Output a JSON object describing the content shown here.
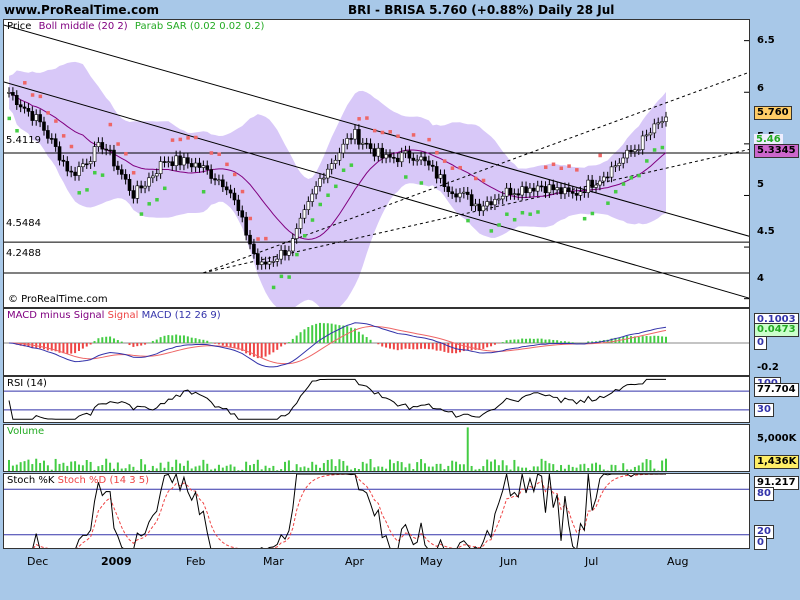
{
  "header": {
    "site": "www.ProRealTime.com",
    "title": "BRI - BRISA 5.760 (+0.88%) Daily 28 Jul"
  },
  "main": {
    "legend": {
      "price": "Price",
      "boll": "Boll middle (20 2)",
      "sar": "Parab SAR (0.02 0.02 0.2)"
    },
    "watermark": "© ProRealTime.com",
    "levels": [
      {
        "label": "5.4119",
        "value": 5.4119
      },
      {
        "label": "4.5484",
        "value": 4.5484
      },
      {
        "label": "4.2488",
        "value": 4.2488
      }
    ],
    "yticks": [
      "6.5",
      "6",
      "5.5",
      "5",
      "4.5",
      "4"
    ],
    "last_price": "5.760",
    "boll_tag": "5.46",
    "sar_tag": "5.3345"
  },
  "macd": {
    "label_a": "MACD minus Signal",
    "label_b": "Signal",
    "label_c": "MACD (12 26 9)",
    "tick": "-0.2",
    "tag_top": "0.1003",
    "tag": "0.0473",
    "tag_zero": "0"
  },
  "rsi": {
    "label": "RSI (14)",
    "tag": "77.704",
    "tag_low": "30",
    "tag_top": "100"
  },
  "volume": {
    "label": "Volume",
    "tick": "5,000K",
    "tag": "1,436K"
  },
  "stoch": {
    "label_a": "Stoch %K",
    "label_b": "Stoch %D (14 3 5)",
    "tag": "91.217",
    "tag_80": "80",
    "tag_20": "20",
    "tag_0": "0"
  },
  "xaxis": [
    "Dec",
    "2009",
    "Feb",
    "Mar",
    "Apr",
    "May",
    "Jun",
    "Jul",
    "Aug"
  ],
  "colors": {
    "bg": "#a8c8e8",
    "boll_fill": "#d8c8f8",
    "sar_up": "#44cc44",
    "sar_down": "#ee6666",
    "macd": "#3333aa",
    "signal": "#ee6666",
    "hist_up": "#44cc44",
    "hist_down": "#ee4444",
    "last_tag": "#ffcc66",
    "sar_tag_color": "#cc66cc"
  },
  "chart_data": {
    "type": "line",
    "title": "BRI - BRISA 5.760 (+0.88%) Daily 28 Jul",
    "xlabel": "",
    "ylabel": "",
    "x": [
      "Dec",
      "2009",
      "Feb",
      "Mar",
      "Apr",
      "May",
      "Jun",
      "Jul",
      "Aug"
    ],
    "ylim": [
      3.9,
      6.7
    ],
    "series": [
      {
        "name": "Price",
        "values": [
          6.0,
          5.7,
          5.2,
          5.5,
          5.0,
          5.35,
          5.3,
          5.1,
          4.3,
          4.5,
          5.2,
          5.6,
          5.35,
          5.4,
          5.1,
          4.9,
          5.05,
          5.1,
          5.0,
          5.2,
          5.45,
          5.76
        ]
      }
    ]
  }
}
